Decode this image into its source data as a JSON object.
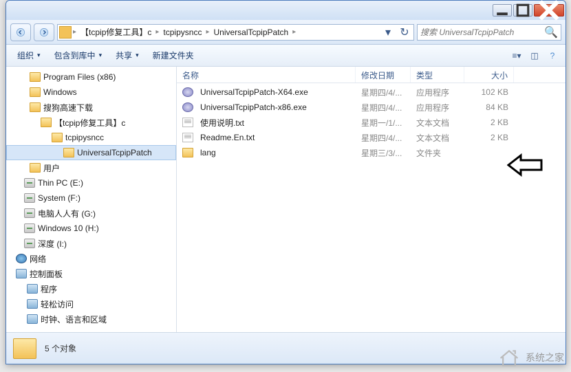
{
  "breadcrumbs": [
    "【tcpip修复工具】c",
    "tcpipysncc",
    "UniversalTcpipPatch"
  ],
  "search": {
    "placeholder": "搜索 UniversalTcpipPatch"
  },
  "toolbar": {
    "organize": "组织",
    "include": "包含到库中",
    "share": "共享",
    "newfolder": "新建文件夹"
  },
  "columns": {
    "name": "名称",
    "date": "修改日期",
    "type": "类型",
    "size": "大小"
  },
  "tree": [
    {
      "label": "Program Files (x86)",
      "icon": "folder-ic",
      "indent": 34
    },
    {
      "label": "Windows",
      "icon": "folder-ic",
      "indent": 34
    },
    {
      "label": "搜狗高速下载",
      "icon": "folder-ic",
      "indent": 34
    },
    {
      "label": "【tcpip修复工具】c",
      "icon": "folder-ic",
      "indent": 50
    },
    {
      "label": "tcpipysncc",
      "icon": "folder-ic",
      "indent": 66
    },
    {
      "label": "UniversalTcpipPatch",
      "icon": "folder-ic",
      "indent": 82,
      "selected": true
    },
    {
      "label": "用户",
      "icon": "folder-ic",
      "indent": 34
    },
    {
      "label": "Thin PC (E:)",
      "icon": "drive-ic",
      "indent": 26
    },
    {
      "label": "System (F:)",
      "icon": "drive-ic",
      "indent": 26
    },
    {
      "label": "电脑人人有 (G:)",
      "icon": "drive-ic",
      "indent": 26
    },
    {
      "label": "Windows 10 (H:)",
      "icon": "drive-ic",
      "indent": 26
    },
    {
      "label": "深度 (I:)",
      "icon": "drive-ic",
      "indent": 26
    },
    {
      "label": "网络",
      "icon": "net-ic",
      "indent": 14
    },
    {
      "label": "控制面板",
      "icon": "cp-ic",
      "indent": 14
    },
    {
      "label": "程序",
      "icon": "cp-ic",
      "indent": 30
    },
    {
      "label": "轻松访问",
      "icon": "cp-ic",
      "indent": 30
    },
    {
      "label": "时钟、语言和区域",
      "icon": "cp-ic",
      "indent": 30
    }
  ],
  "files": [
    {
      "name": "UniversalTcpipPatch-X64.exe",
      "icon": "exe-ic",
      "date": "星期四/4/...",
      "type": "应用程序",
      "size": "102 KB"
    },
    {
      "name": "UniversalTcpipPatch-x86.exe",
      "icon": "exe-ic",
      "date": "星期四/4/...",
      "type": "应用程序",
      "size": "84 KB"
    },
    {
      "name": "使用说明.txt",
      "icon": "txt-ic",
      "date": "星期一/1/...",
      "type": "文本文档",
      "size": "2 KB"
    },
    {
      "name": "Readme.En.txt",
      "icon": "txt-ic",
      "date": "星期四/4/...",
      "type": "文本文档",
      "size": "2 KB"
    },
    {
      "name": "lang",
      "icon": "folder-ic",
      "date": "星期三/3/...",
      "type": "文件夹",
      "size": ""
    }
  ],
  "status": {
    "count": "5 个对象"
  },
  "watermark": "系统之家"
}
